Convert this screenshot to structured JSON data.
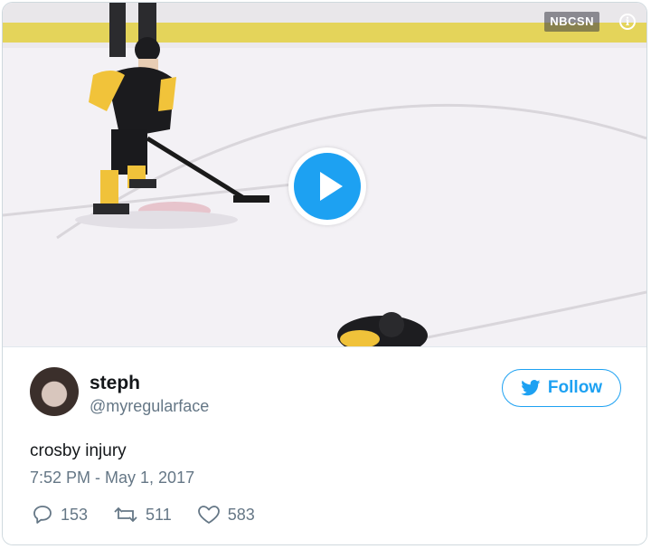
{
  "video": {
    "network_logo": "NBCSN",
    "play_icon": "play-icon",
    "info_icon": "info-icon"
  },
  "tweet": {
    "name": "steph",
    "handle": "@myregularface",
    "follow_label": "Follow",
    "text": "crosby injury",
    "timestamp": "7:52 PM - May 1, 2017",
    "replies": "153",
    "retweets": "511",
    "likes": "583"
  },
  "colors": {
    "accent": "#1da1f2",
    "secondary_text": "#657786",
    "primary_text": "#14171a"
  }
}
